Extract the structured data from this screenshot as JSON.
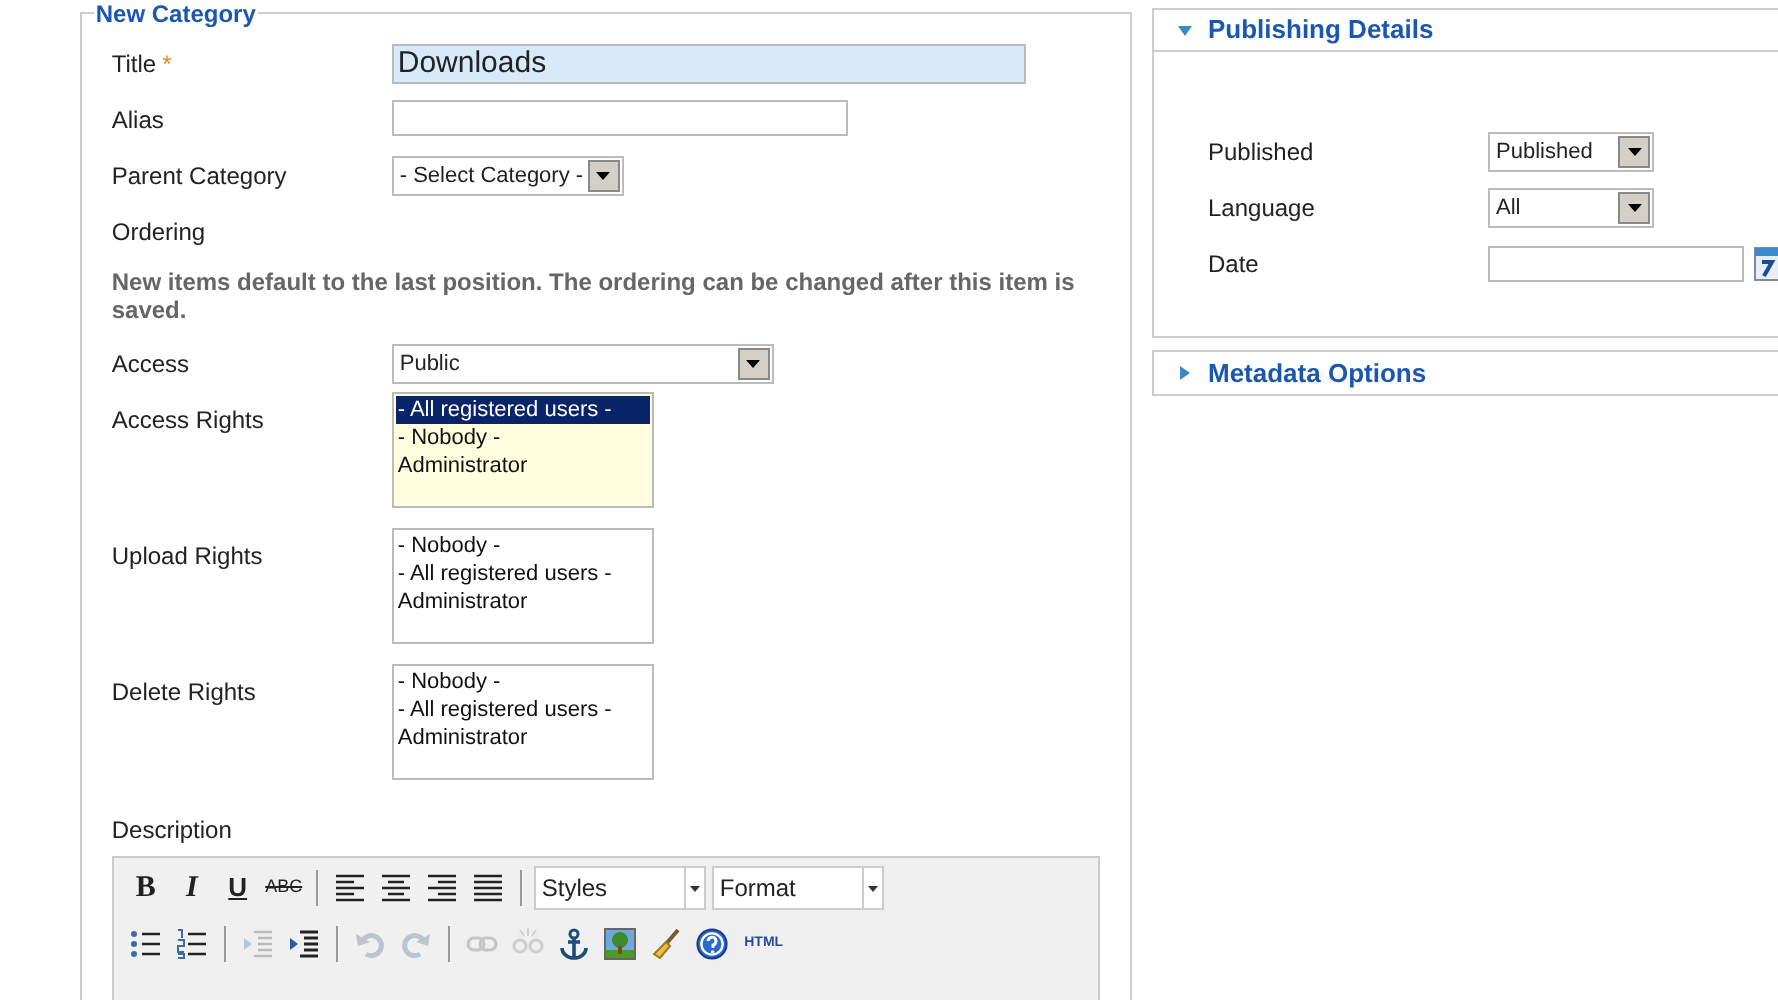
{
  "form": {
    "legend": "New Category",
    "fields": [
      {
        "kind": "text",
        "label": "Title",
        "required_mark": "*",
        "value": "Downloads",
        "focused": true
      },
      {
        "kind": "text",
        "label": "Alias",
        "focused": false
      },
      {
        "kind": "select",
        "label": "Parent Category",
        "value": "- Select Category -"
      },
      {
        "kind": "note",
        "label": "Ordering",
        "note": "New items default to the last position. The ordering can be changed after this item is saved."
      },
      {
        "kind": "select",
        "label": "Access",
        "value": "Public"
      },
      {
        "kind": "listbox",
        "label": "Access Rights",
        "focused": true,
        "options": [
          {
            "text": "- All registered users -",
            "selected": true
          },
          {
            "text": "- Nobody -",
            "selected": false
          },
          {
            "text": "Administrator",
            "selected": false
          }
        ]
      },
      {
        "kind": "listbox",
        "label": "Upload Rights",
        "focused": false,
        "options": [
          {
            "text": "- Nobody -",
            "selected": false
          },
          {
            "text": "- All registered users -",
            "selected": false
          },
          {
            "text": "Administrator",
            "selected": false
          }
        ]
      },
      {
        "kind": "listbox",
        "label": "Delete Rights",
        "focused": false,
        "options": [
          {
            "text": "- Nobody -",
            "selected": false
          },
          {
            "text": "- All registered users -",
            "selected": false
          },
          {
            "text": "Administrator",
            "selected": false
          }
        ]
      }
    ],
    "description": {
      "label": "Description",
      "toolbar_rows": [
        [
          {
            "kind": "text",
            "text": "B"
          },
          {
            "kind": "text",
            "text": "I"
          },
          {
            "kind": "text",
            "text": "U"
          },
          {
            "kind": "text",
            "text": "ABC"
          },
          {
            "kind": "sep"
          },
          {
            "kind": "icon"
          },
          {
            "kind": "icon"
          },
          {
            "kind": "icon"
          },
          {
            "kind": "icon"
          },
          {
            "kind": "sep"
          },
          {
            "kind": "dropdown",
            "text": "Styles"
          },
          {
            "kind": "dropdown",
            "text": "Format"
          }
        ],
        [
          {
            "kind": "icon"
          },
          {
            "kind": "icon"
          },
          {
            "kind": "sep"
          },
          {
            "kind": "icon",
            "disabled": true
          },
          {
            "kind": "icon",
            "disabled": false
          },
          {
            "kind": "sep"
          },
          {
            "kind": "icon",
            "disabled": true
          },
          {
            "kind": "icon",
            "disabled": true
          },
          {
            "kind": "sep"
          },
          {
            "kind": "icon",
            "disabled": true
          },
          {
            "kind": "icon",
            "disabled": true
          },
          {
            "kind": "icon"
          },
          {
            "kind": "icon"
          },
          {
            "kind": "icon"
          },
          {
            "kind": "icon"
          },
          {
            "kind": "text",
            "text": "HTML"
          }
        ]
      ]
    }
  },
  "panels": [
    {
      "title": "Publishing Details",
      "expanded": true,
      "fields": [
        {
          "kind": "select",
          "label": "Published",
          "value": "Published"
        },
        {
          "kind": "select",
          "label": "Language",
          "value": "All"
        },
        {
          "kind": "date",
          "label": "Date"
        }
      ]
    },
    {
      "title": "Metadata Options",
      "expanded": false
    }
  ]
}
